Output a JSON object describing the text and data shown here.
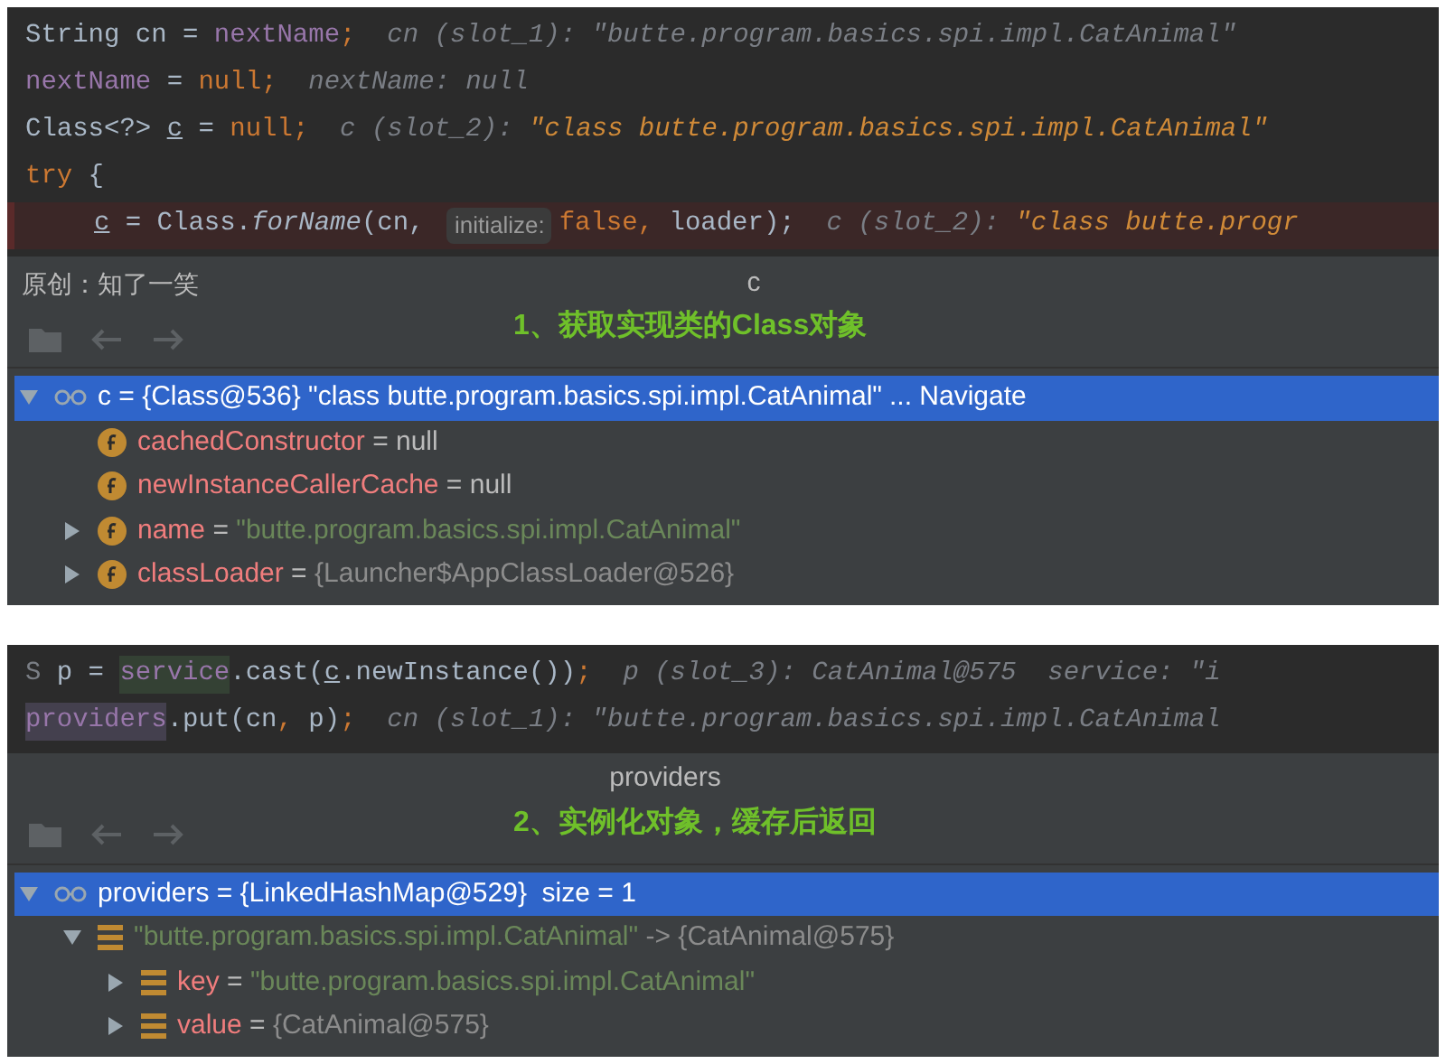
{
  "panels": [
    {
      "code_lines": [
        {
          "breakpoint": false,
          "segments": [
            {
              "kind": "plain",
              "text": "String cn = "
            },
            {
              "kind": "field",
              "text": "nextName"
            },
            {
              "kind": "keyword",
              "text": ";"
            },
            {
              "kind": "hint",
              "text": "  cn (slot_1): \"butte.program.basics.spi.impl.CatAnimal\""
            }
          ]
        },
        {
          "breakpoint": false,
          "segments": [
            {
              "kind": "field",
              "text": "nextName"
            },
            {
              "kind": "plain",
              "text": " = "
            },
            {
              "kind": "keyword",
              "text": "null;"
            },
            {
              "kind": "hint",
              "text": "  nextName: null"
            }
          ]
        },
        {
          "breakpoint": false,
          "segments": [
            {
              "kind": "plain",
              "text": "Class<?> "
            },
            {
              "kind": "underlined",
              "text": "c"
            },
            {
              "kind": "plain",
              "text": " = "
            },
            {
              "kind": "keyword",
              "text": "null;"
            },
            {
              "kind": "hint",
              "text": "  c (slot_2): "
            },
            {
              "kind": "hint_value",
              "text": "\"class butte.program.basics.spi.impl.CatAnimal\""
            }
          ]
        },
        {
          "breakpoint": false,
          "segments": [
            {
              "kind": "keyword",
              "text": "try"
            },
            {
              "kind": "plain",
              "text": " {"
            }
          ]
        },
        {
          "breakpoint": true,
          "indented": true,
          "segments": [
            {
              "kind": "underlined",
              "text": "c"
            },
            {
              "kind": "plain",
              "text": " = Class."
            },
            {
              "kind": "method",
              "text": "forName"
            },
            {
              "kind": "plain",
              "text": "(cn, "
            },
            {
              "kind": "param",
              "text": "initialize:"
            },
            {
              "kind": "keyword",
              "text": "false, "
            },
            {
              "kind": "plain",
              "text": "loader);"
            },
            {
              "kind": "hint",
              "text": "  c (slot_2): "
            },
            {
              "kind": "hint_value",
              "text": "\"class butte.progr"
            }
          ]
        }
      ],
      "status_left": "原创：知了一笑",
      "header": "c",
      "caption": "1、获取实现类的Class对象",
      "tree": [
        {
          "kind": "watch",
          "expanded": true,
          "selected": true,
          "segments": [
            {
              "kind": "plain",
              "text": "c = {Class@536} \"class butte.program.basics.spi.impl.CatAnimal\""
            },
            {
              "kind": "link",
              "text": "... Navigate"
            }
          ],
          "children": [
            {
              "kind": "field",
              "selected": false,
              "segments": [
                {
                  "kind": "name",
                  "text": "cachedConstructor"
                },
                {
                  "kind": "op",
                  "text": " = null"
                }
              ]
            },
            {
              "kind": "field",
              "selected": false,
              "segments": [
                {
                  "kind": "name",
                  "text": "newInstanceCallerCache"
                },
                {
                  "kind": "op",
                  "text": " = null"
                }
              ]
            },
            {
              "kind": "field",
              "expanded": false,
              "selected": false,
              "segments": [
                {
                  "kind": "name",
                  "text": "name"
                },
                {
                  "kind": "op",
                  "text": " = "
                },
                {
                  "kind": "string",
                  "text": "\"butte.program.basics.spi.impl.CatAnimal\""
                }
              ]
            },
            {
              "kind": "field",
              "expanded": false,
              "selected": false,
              "segments": [
                {
                  "kind": "name",
                  "text": "classLoader"
                },
                {
                  "kind": "op",
                  "text": " = "
                },
                {
                  "kind": "value",
                  "text": "{Launcher$AppClassLoader@526}"
                }
              ]
            }
          ]
        }
      ]
    },
    {
      "code_lines": [
        {
          "breakpoint": false,
          "segments": [
            {
              "kind": "dim",
              "text": "S "
            },
            {
              "kind": "plain",
              "text": "p = "
            },
            {
              "kind": "highlight",
              "text": "service"
            },
            {
              "kind": "plain",
              "text": ".cast("
            },
            {
              "kind": "underlined",
              "text": "c"
            },
            {
              "kind": "plain",
              "text": ".newInstance())"
            },
            {
              "kind": "keyword",
              "text": ";"
            },
            {
              "kind": "hint",
              "text": "  p (slot_3): CatAnimal@575  service: \"i"
            }
          ]
        },
        {
          "breakpoint": false,
          "segments": [
            {
              "kind": "field_highlight",
              "text": "providers"
            },
            {
              "kind": "plain",
              "text": ".put(cn"
            },
            {
              "kind": "keyword",
              "text": ", "
            },
            {
              "kind": "plain",
              "text": "p)"
            },
            {
              "kind": "keyword",
              "text": ";"
            },
            {
              "kind": "hint",
              "text": "  cn (slot_1): \"butte.program.basics.spi.impl.CatAnimal"
            }
          ]
        }
      ],
      "header": "providers",
      "caption": "2、实例化对象，缓存后返回",
      "tree": [
        {
          "kind": "watch",
          "expanded": true,
          "selected": true,
          "segments": [
            {
              "kind": "plain",
              "text": "providers = {LinkedHashMap@529}  size = 1"
            }
          ],
          "children": [
            {
              "kind": "entry",
              "expanded": true,
              "selected": false,
              "segments": [
                {
                  "kind": "string",
                  "text": "\"butte.program.basics.spi.impl.CatAnimal\""
                },
                {
                  "kind": "value",
                  "text": " -> {CatAnimal@575}"
                }
              ],
              "children": [
                {
                  "kind": "entry",
                  "expanded": false,
                  "selected": false,
                  "segments": [
                    {
                      "kind": "name",
                      "text": "key"
                    },
                    {
                      "kind": "op",
                      "text": " = "
                    },
                    {
                      "kind": "string",
                      "text": "\"butte.program.basics.spi.impl.CatAnimal\""
                    }
                  ]
                },
                {
                  "kind": "entry",
                  "expanded": false,
                  "selected": false,
                  "segments": [
                    {
                      "kind": "name",
                      "text": "value"
                    },
                    {
                      "kind": "op",
                      "text": " = "
                    },
                    {
                      "kind": "value",
                      "text": "{CatAnimal@575}"
                    }
                  ]
                }
              ]
            }
          ]
        }
      ]
    }
  ]
}
